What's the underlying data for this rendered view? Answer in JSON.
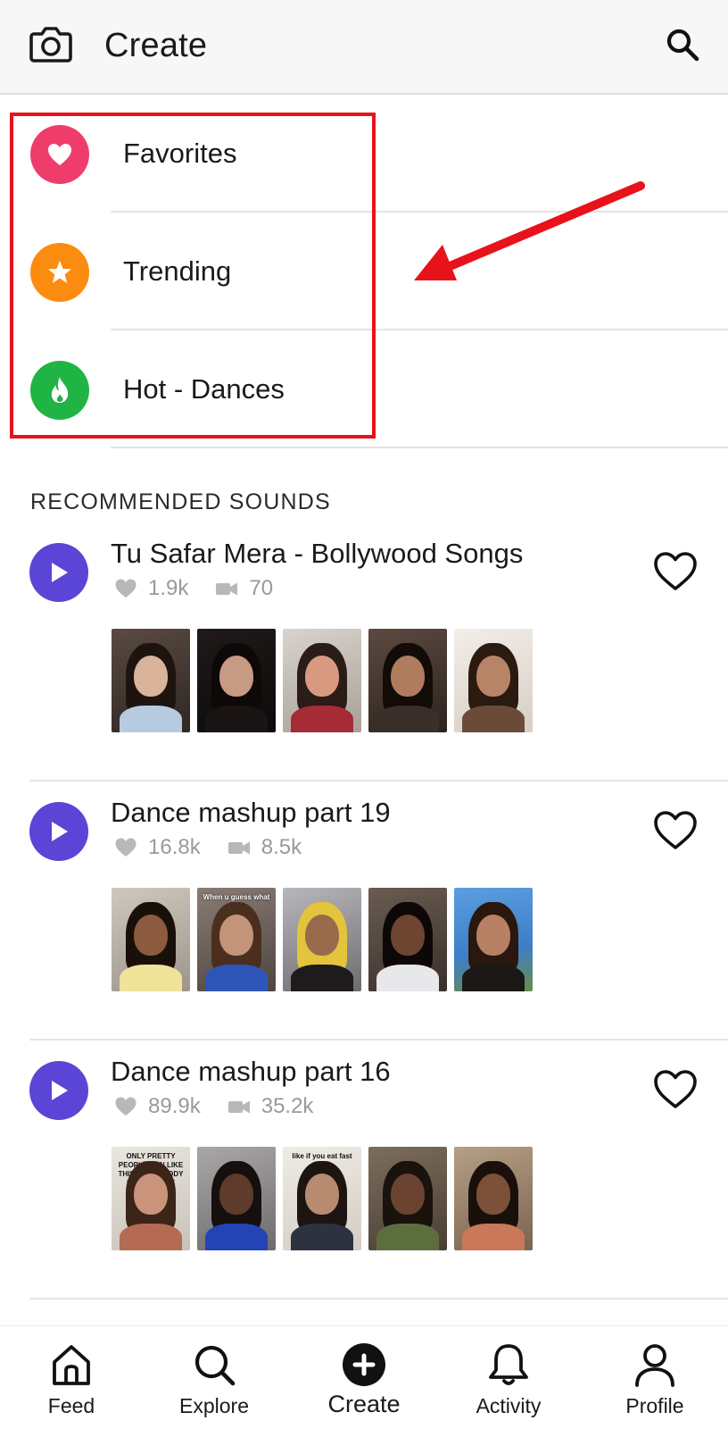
{
  "header": {
    "title": "Create",
    "left_icon": "camera-icon",
    "right_icon": "search-icon"
  },
  "categories": [
    {
      "label": "Favorites",
      "icon": "heart-icon",
      "color": "#ef3d6b"
    },
    {
      "label": "Trending",
      "icon": "star-icon",
      "color": "#fb8c10"
    },
    {
      "label": "Hot - Dances",
      "icon": "flame-icon",
      "color": "#20b444"
    }
  ],
  "section_title": "RECOMMENDED SOUNDS",
  "sounds": [
    {
      "title": "Tu Safar Mera - Bollywood Songs",
      "likes": "1.9k",
      "videos": "70",
      "thumbnails": [
        {
          "caption": ""
        },
        {
          "caption": ""
        },
        {
          "caption": ""
        },
        {
          "caption": ""
        },
        {
          "caption": ""
        }
      ]
    },
    {
      "title": "Dance mashup part 19",
      "likes": "16.8k",
      "videos": "8.5k",
      "thumbnails": [
        {
          "caption": ""
        },
        {
          "caption": "When u guess what I got"
        },
        {
          "caption": ""
        },
        {
          "caption": ""
        },
        {
          "caption": ""
        }
      ]
    },
    {
      "title": "Dance mashup part 16",
      "likes": "89.9k",
      "videos": "35.2k",
      "thumbnails": [
        {
          "caption": "ONLY PRETTY PEOPLE CAN LIKE THIS! EVERYBODY SHOULD LIKE THIS!"
        },
        {
          "caption": ""
        },
        {
          "caption": "like if you eat fast food"
        },
        {
          "caption": ""
        },
        {
          "caption": ""
        }
      ]
    }
  ],
  "tabs": [
    {
      "label": "Feed",
      "icon": "home-icon"
    },
    {
      "label": "Explore",
      "icon": "search-icon"
    },
    {
      "label": "Create",
      "icon": "plus-circle-icon"
    },
    {
      "label": "Activity",
      "icon": "bell-icon"
    },
    {
      "label": "Profile",
      "icon": "person-icon"
    }
  ],
  "colors": {
    "accent_purple": "#5b45d6",
    "highlight_red": "#e8121b",
    "muted_text": "#9a9a9a"
  }
}
